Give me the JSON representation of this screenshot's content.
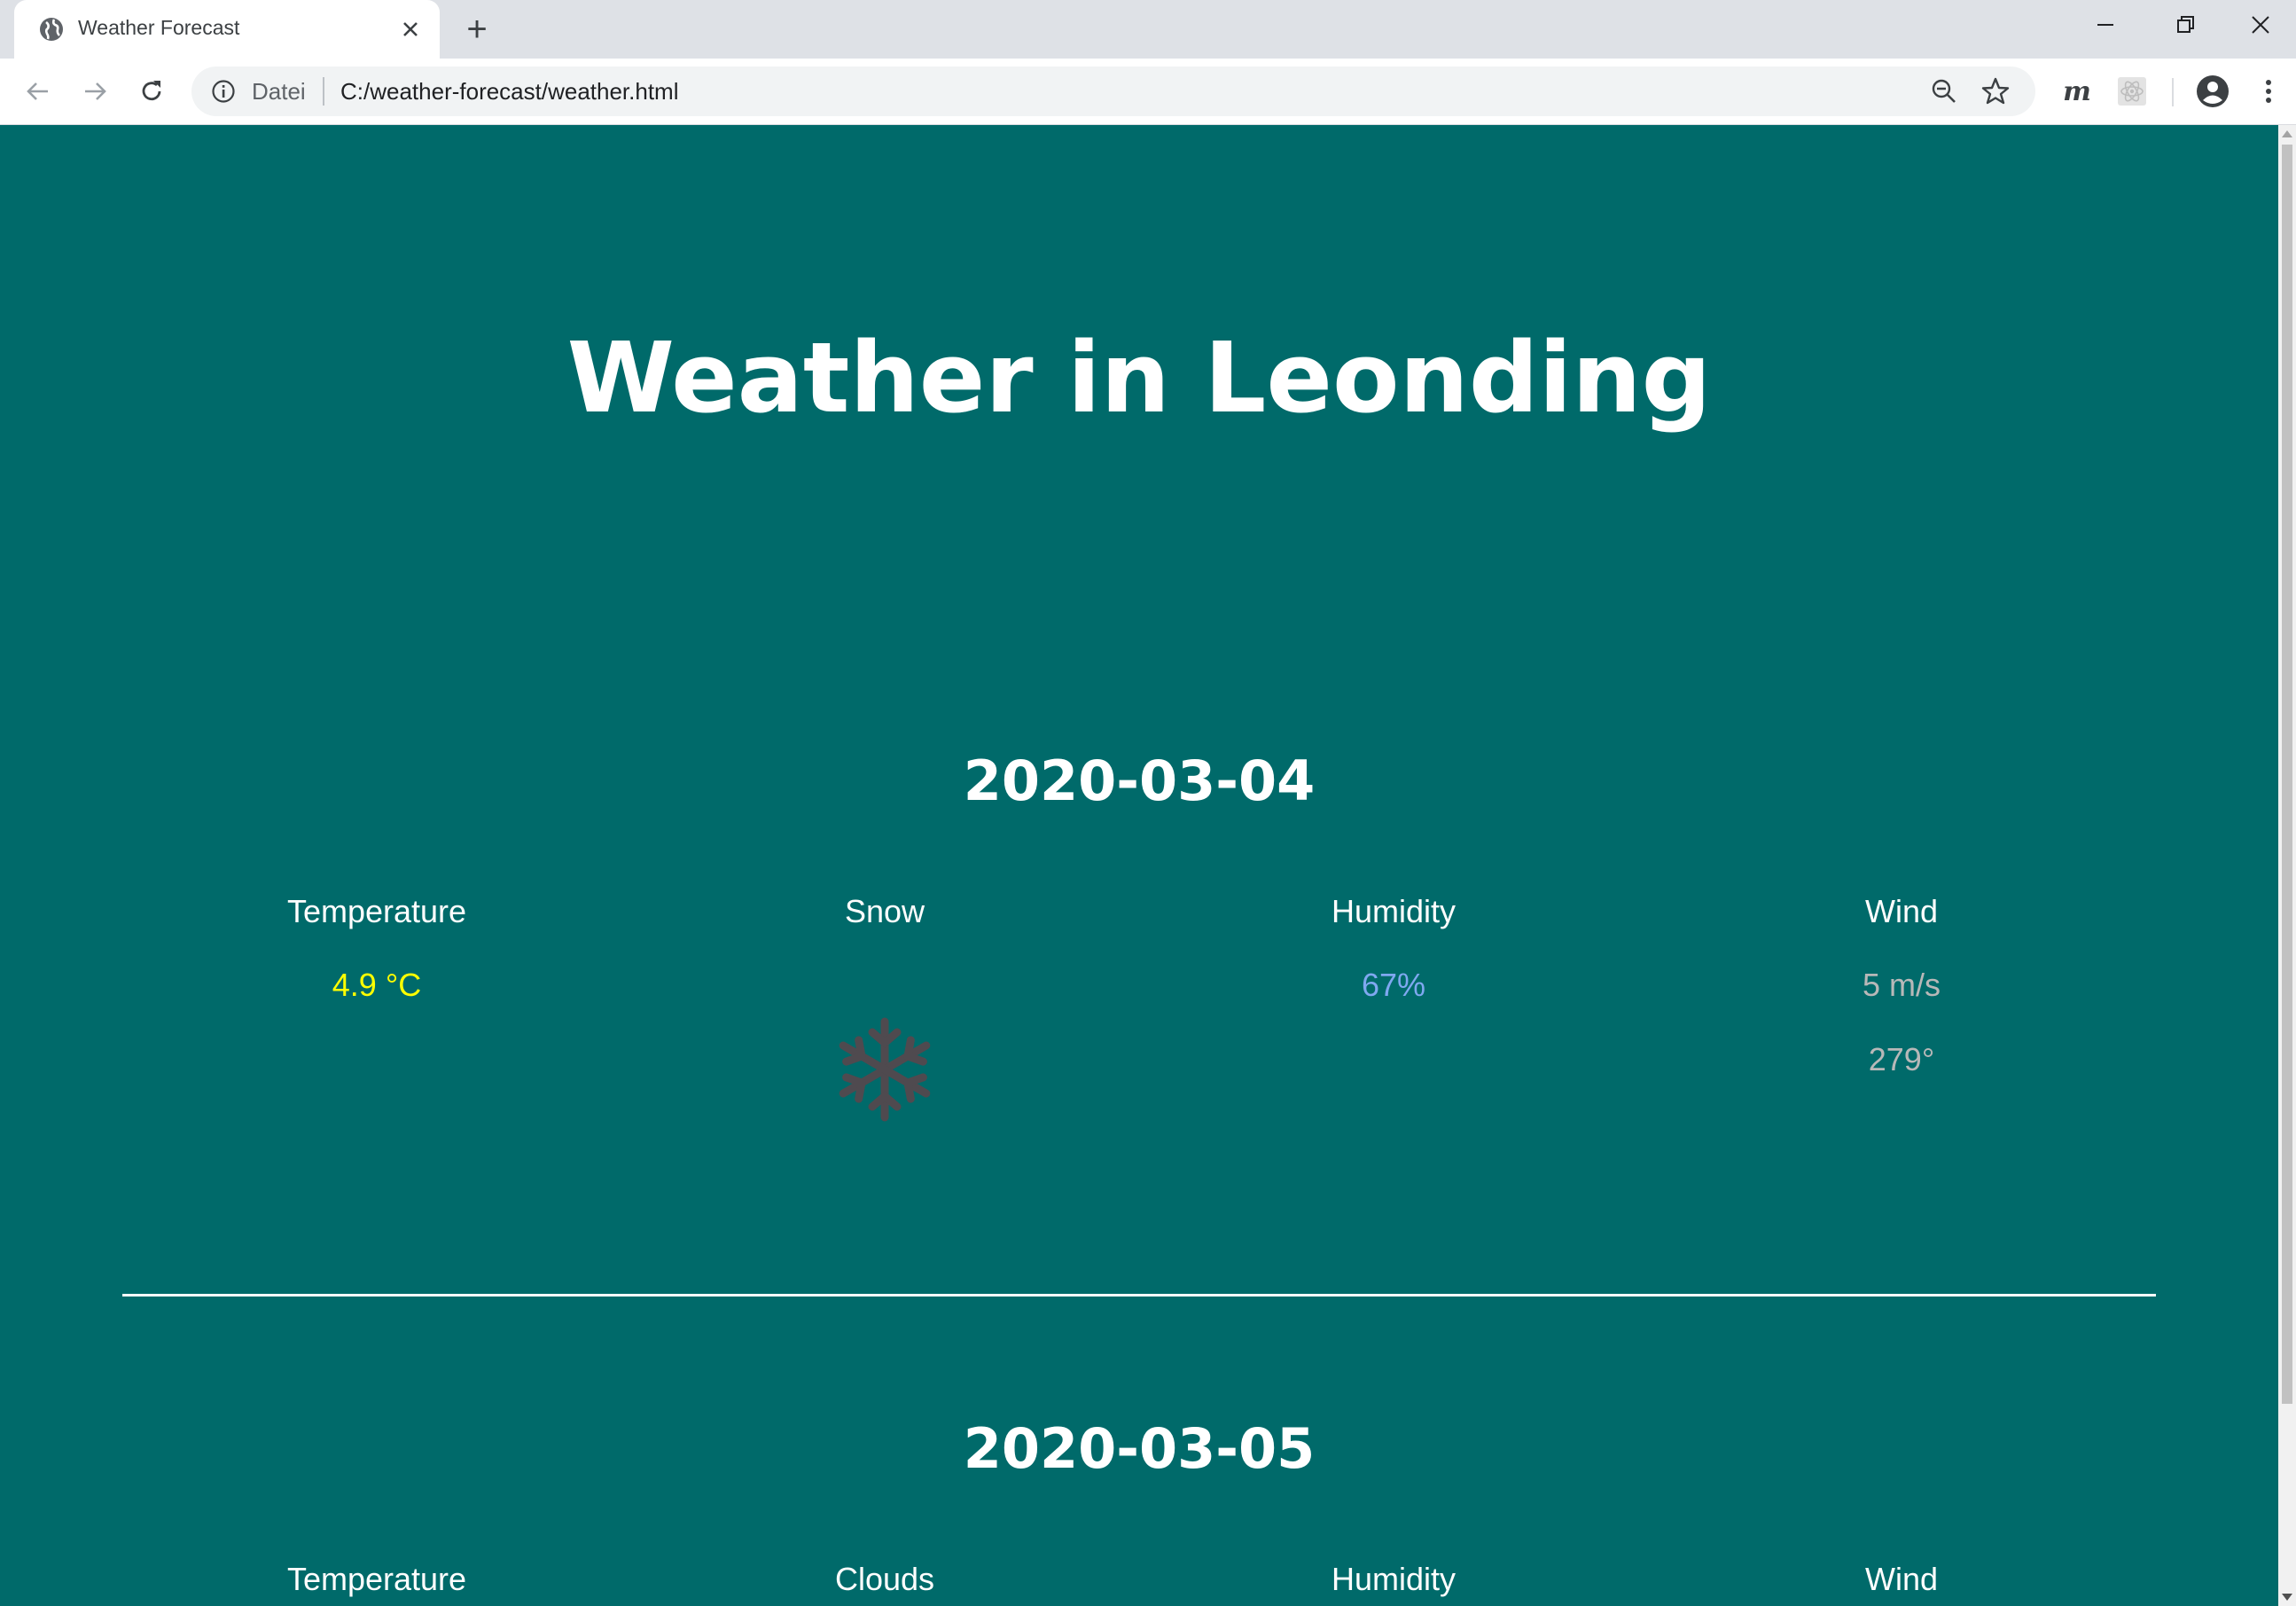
{
  "browser": {
    "tab_title": "Weather Forecast",
    "new_tab": "+",
    "scheme_label": "Datei",
    "url": "C:/weather-forecast/weather.html",
    "extension_m": "m"
  },
  "page": {
    "title": "Weather in Leonding",
    "colors": {
      "background": "#006a6a",
      "temperature": "#ffff00",
      "humidity": "#7fa8f0",
      "wind": "#b8b8b8",
      "snow_icon": "#4f4a4f"
    },
    "days": [
      {
        "date": "2020-03-04",
        "temperature_label": "Temperature",
        "temperature_value": "4.9 °C",
        "condition_label": "Snow",
        "condition_icon": "snowflake-icon",
        "humidity_label": "Humidity",
        "humidity_value": "67%",
        "wind_label": "Wind",
        "wind_speed": "5 m/s",
        "wind_direction": "279°"
      },
      {
        "date": "2020-03-05",
        "temperature_label": "Temperature",
        "condition_label": "Clouds",
        "humidity_label": "Humidity",
        "wind_label": "Wind"
      }
    ]
  }
}
